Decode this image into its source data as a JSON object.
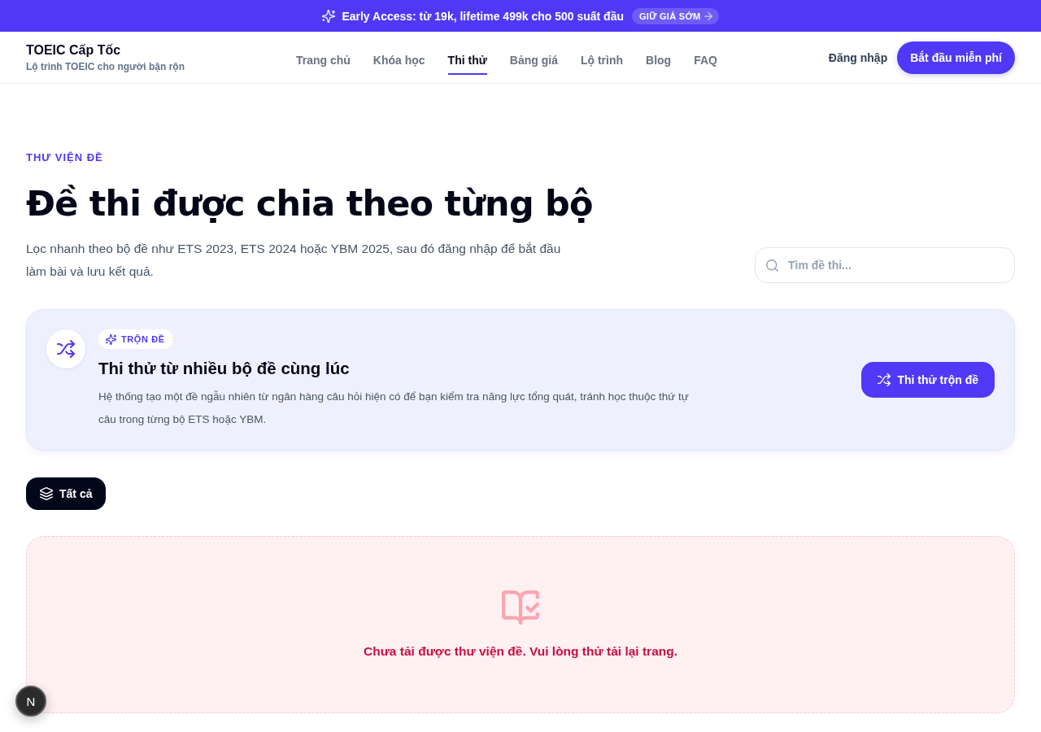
{
  "announcement": {
    "text": "Early Access: từ 19k, lifetime 499k cho 500 suất đầu",
    "cta": "GIỮ GIÁ SỚM"
  },
  "header": {
    "brand": "TOEIC Cấp Tốc",
    "tagline": "Lộ trình TOEIC cho người bận rộn",
    "nav": [
      {
        "label": "Trang chủ",
        "selected": false
      },
      {
        "label": "Khóa học",
        "selected": false
      },
      {
        "label": "Thi thử",
        "selected": true
      },
      {
        "label": "Bảng giá",
        "selected": false
      },
      {
        "label": "Lộ trình",
        "selected": false
      },
      {
        "label": "Blog",
        "selected": false
      },
      {
        "label": "FAQ",
        "selected": false
      }
    ],
    "login": "Đăng nhập",
    "cta": "Bắt đầu miễn phí"
  },
  "hero": {
    "eyebrow": "THƯ VIỆN ĐỀ",
    "title": "Đề thi được chia theo từng bộ",
    "description": "Lọc nhanh theo bộ đề như ETS 2023, ETS 2024 hoặc YBM 2025, sau đó đăng nhập để bắt đầu làm bài và lưu kết quả.",
    "search": {
      "placeholder": "Tìm đề thi..."
    }
  },
  "mix_card": {
    "badge": "TRỘN ĐỀ",
    "title": "Thi thử từ nhiều bộ đề cùng lúc",
    "description": "Hệ thống tạo một đề ngẫu nhiên từ ngân hàng câu hỏi hiện có để bạn kiểm tra năng lực tổng quát, tránh học thuộc thứ tự câu trong từng bộ ETS hoặc YBM.",
    "button": "Thi thử trộn đề"
  },
  "filters": [
    {
      "label": "Tất cả",
      "selected": true
    }
  ],
  "empty_state": {
    "message": "Chưa tải được thư viện đề. Vui lòng thử tải lại trang."
  },
  "dev_badge": {
    "label": "N"
  }
}
